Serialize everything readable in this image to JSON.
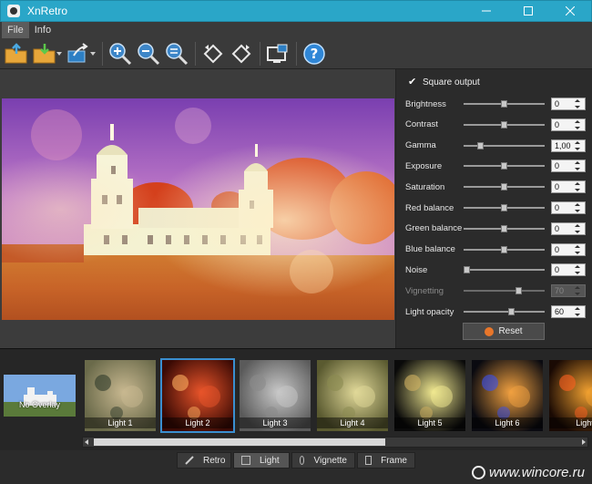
{
  "window": {
    "title": "XnRetro",
    "controls": [
      "minimize",
      "maximize",
      "close"
    ]
  },
  "menu": {
    "items": [
      {
        "label": "File"
      },
      {
        "label": "Info"
      }
    ]
  },
  "toolbar": {
    "buttons": [
      {
        "icon": "folder-open-icon"
      },
      {
        "icon": "folder-save-icon",
        "dropdown": true
      },
      {
        "icon": "export-icon",
        "dropdown": true
      },
      {
        "icon": "zoom-in-icon"
      },
      {
        "icon": "zoom-out-icon"
      },
      {
        "icon": "zoom-fit-icon"
      },
      {
        "icon": "rotate-left-icon"
      },
      {
        "icon": "rotate-right-icon"
      },
      {
        "icon": "fullscreen-icon"
      },
      {
        "icon": "help-icon"
      }
    ]
  },
  "adjustments": {
    "square_output_label": "Square output",
    "square_output_checked": true,
    "rows": [
      {
        "label": "Brightness",
        "value": "0",
        "level": 0.5,
        "disabled": false
      },
      {
        "label": "Contrast",
        "value": "0",
        "level": 0.5,
        "disabled": false
      },
      {
        "label": "Gamma",
        "value": "1,00",
        "level": 0.18,
        "disabled": false
      },
      {
        "label": "Exposure",
        "value": "0",
        "level": 0.5,
        "disabled": false
      },
      {
        "label": "Saturation",
        "value": "0",
        "level": 0.5,
        "disabled": false
      },
      {
        "label": "Red balance",
        "value": "0",
        "level": 0.5,
        "disabled": false
      },
      {
        "label": "Green balance",
        "value": "0",
        "level": 0.5,
        "disabled": false
      },
      {
        "label": "Blue balance",
        "value": "0",
        "level": 0.5,
        "disabled": false
      },
      {
        "label": "Noise",
        "value": "0",
        "level": 0.0,
        "disabled": false
      },
      {
        "label": "Vignetting",
        "value": "70",
        "level": 0.7,
        "disabled": true
      },
      {
        "label": "Light opacity",
        "value": "60",
        "level": 0.6,
        "disabled": false
      }
    ],
    "reset_label": "Reset"
  },
  "overlays": {
    "no_overlay_label": "No Overlay",
    "items": [
      {
        "label": "Light 1",
        "selected": false
      },
      {
        "label": "Light 2",
        "selected": true
      },
      {
        "label": "Light 3",
        "selected": false
      },
      {
        "label": "Light 4",
        "selected": false
      },
      {
        "label": "Light 5",
        "selected": false
      },
      {
        "label": "Light 6",
        "selected": false
      },
      {
        "label": "Light",
        "selected": false
      }
    ]
  },
  "tabs": [
    {
      "label": "Retro",
      "icon": "retro-icon",
      "active": false
    },
    {
      "label": "Light",
      "icon": "light-icon",
      "active": true
    },
    {
      "label": "Vignette",
      "icon": "vignette-icon",
      "active": false
    },
    {
      "label": "Frame",
      "icon": "frame-icon",
      "active": false
    }
  ],
  "watermark": "www.wincore.ru",
  "colors": {
    "titlebar": "#2aa6c8",
    "selection": "#3a8fd0",
    "reset_icon": "#e8762a"
  }
}
